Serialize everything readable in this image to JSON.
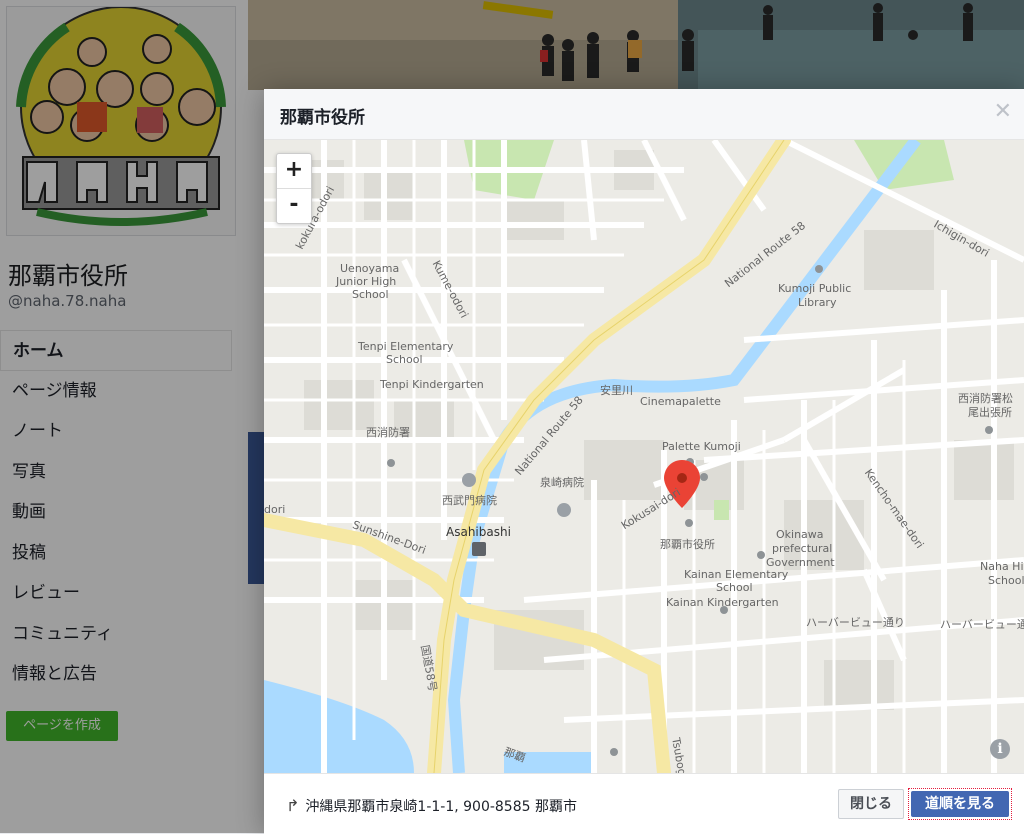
{
  "sidebar": {
    "page_name": "那覇市役所",
    "handle": "@naha.78.naha",
    "items": [
      {
        "label": "ホーム"
      },
      {
        "label": "ページ情報"
      },
      {
        "label": "ノート"
      },
      {
        "label": "写真"
      },
      {
        "label": "動画"
      },
      {
        "label": "投稿"
      },
      {
        "label": "レビュー"
      },
      {
        "label": "コミュニティ"
      },
      {
        "label": "情報と広告"
      }
    ],
    "create_page_label": "ページを作成"
  },
  "dialog": {
    "title": "那覇市役所",
    "close_icon": "close-x-icon",
    "zoom_in": "+",
    "zoom_out": "-",
    "info": "i",
    "address": "沖縄県那覇市泉崎1-1-1, 900-8585 那覇市",
    "close_button": "閉じる",
    "directions_button": "道順を見る"
  },
  "map": {
    "labels": {
      "national_route_58_n": "National Route 58",
      "national_route_58_s": "National Route 58",
      "kume_odori": "Kume-odori",
      "kokura_odori": "kokura-odori",
      "uenoyama_1": "Uenoyama",
      "uenoyama_2": "Junior High",
      "uenoyama_3": "School",
      "tenpi_elem_1": "Tenpi Elementary",
      "tenpi_elem_2": "School",
      "tenpi_kinder": "Tenpi Kindergarten",
      "nishi_fire": "西消防署",
      "kumoji_lib_1": "Kumoji Public",
      "kumoji_lib_2": "Library",
      "ichigin": "Ichigin-dori",
      "nishi_fire_matsuo_1": "西消防署松",
      "nishi_fire_matsuo_2": "尾出張所",
      "cinemapalette": "Cinemapalette",
      "tomari_river": "安里川",
      "palette_kumoji": "Palette Kumoji",
      "izumizaki_hosp": "泉崎病院",
      "nishibu_hosp": "西武門病院",
      "kokusai_dori": "Kokusai-dori",
      "kencho_mae": "Kencho-mae-dori",
      "sunshine": "Sunshine-Dori",
      "asahibashi": "Asahibashi",
      "naha_city_hall": "那覇市役所",
      "okinawa_gov_1": "Okinawa",
      "okinawa_gov_2": "prefectural",
      "okinawa_gov_3": "Government",
      "kainan_elem_1": "Kainan Elementary",
      "kainan_elem_2": "School",
      "kainan_kinder": "Kainan Kindergarten",
      "harbor_view_1": "ハーバービュー通り",
      "harbor_view_2": "ハーバービュー通",
      "naha_high_1": "Naha Hi",
      "naha_high_2": "School",
      "kokudo_58": "国道58号",
      "tsubogawa": "Tsubogawa",
      "naha_road": "那覇",
      "dori_edge": "dori"
    }
  }
}
